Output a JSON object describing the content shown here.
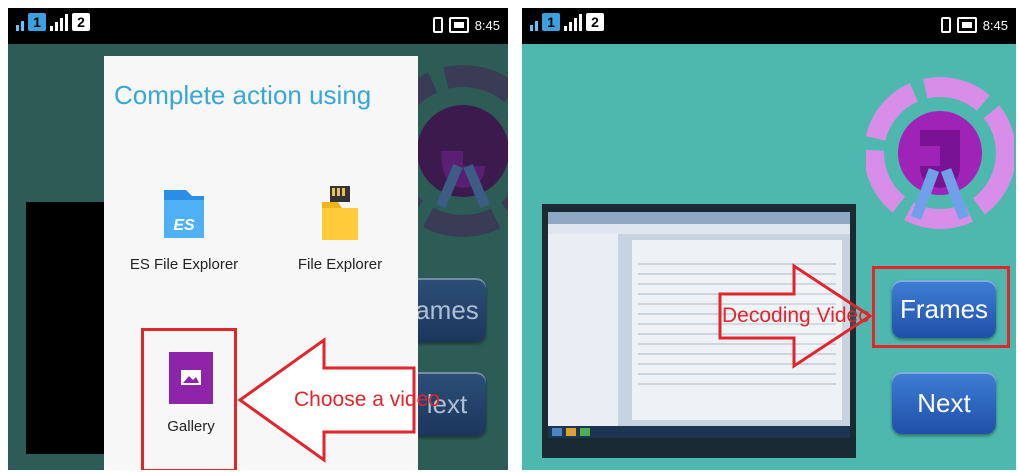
{
  "left_screen": {
    "status": {
      "sim1": "1",
      "sim2": "2",
      "time": "8:45"
    },
    "dialog": {
      "title": "Complete action using",
      "apps": [
        {
          "label": "ES File Explorer",
          "icon": "es-file-explorer-icon"
        },
        {
          "label": "File Explorer",
          "icon": "file-explorer-icon"
        },
        {
          "label": "Gallery",
          "icon": "gallery-icon"
        }
      ]
    },
    "buttons_behind": {
      "frames_partial": "ames",
      "next_partial": "lext"
    },
    "annotation": "Choose a video"
  },
  "right_screen": {
    "status": {
      "sim1": "1",
      "sim2": "2",
      "time": "8:45"
    },
    "buttons": {
      "frames": "Frames",
      "next": "Next"
    },
    "annotation": "Decoding Video"
  },
  "colors": {
    "annotation_red": "#e0262b",
    "dialog_title": "#36a7d6",
    "teal_background": "#4fb8ae",
    "button_blue": "#2a5fbf",
    "gallery_purple": "#8e24aa"
  }
}
